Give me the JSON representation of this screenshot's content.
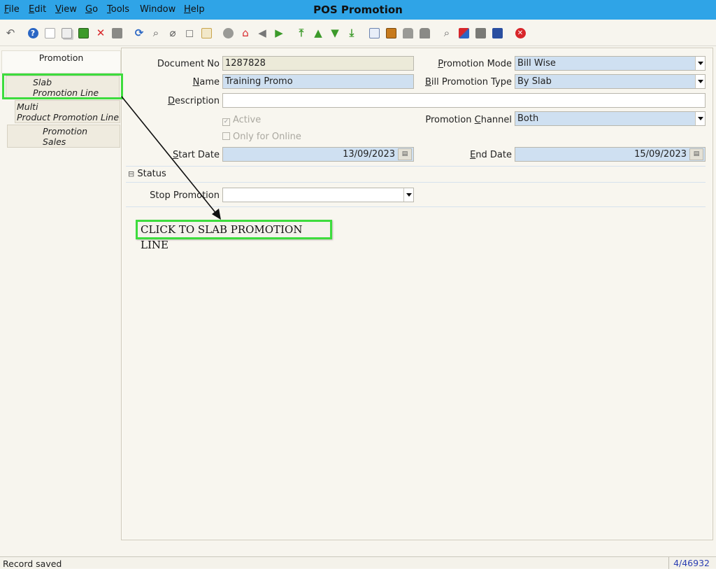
{
  "window": {
    "title": "POS Promotion"
  },
  "menu": [
    {
      "label": "File",
      "mnemonic": "F",
      "rest": "ile"
    },
    {
      "label": "Edit",
      "mnemonic": "E",
      "rest": "dit"
    },
    {
      "label": "View",
      "mnemonic": "V",
      "rest": "iew"
    },
    {
      "label": "Go",
      "mnemonic": "G",
      "rest": "o"
    },
    {
      "label": "Tools",
      "mnemonic": "T",
      "rest": "ools"
    },
    {
      "label": "Window",
      "mnemonic": "",
      "rest": "Window"
    },
    {
      "label": "Help",
      "mnemonic": "H",
      "rest": "elp"
    }
  ],
  "toolbar": {
    "icons": [
      "undo-icon",
      "help-icon",
      "new-record-icon",
      "copy-record-icon",
      "save-icon",
      "delete-icon",
      "save-disk-icon",
      "refresh-icon",
      "find-icon",
      "attachment-icon",
      "chat-icon",
      "grid-toggle-icon",
      "history-icon",
      "home-icon",
      "back-icon",
      "forward-icon",
      "first-record-icon",
      "previous-record-icon",
      "next-record-icon",
      "last-record-icon",
      "report-icon",
      "archive-icon",
      "print-preview-icon",
      "print-icon",
      "zoom-across-icon",
      "workflow-icon",
      "product-info-icon",
      "lock-icon",
      "exit-icon"
    ],
    "colors": {
      "green": "#3c9a2a",
      "blue": "#2a66c4",
      "grey": "#8a8a86",
      "red": "#d8262a",
      "orange": "#e07020"
    }
  },
  "tabs": [
    {
      "line1": "Promotion",
      "line2": ""
    },
    {
      "line1": "Slab",
      "line2": "Promotion Line"
    },
    {
      "line1": "Multi",
      "line2": "Product Promotion Line"
    },
    {
      "line1": "Promotion",
      "line2": "Sales"
    }
  ],
  "form": {
    "document_no": {
      "label": "Document No",
      "value": "1287828"
    },
    "name": {
      "label_mn": "N",
      "label_rest": "ame",
      "value": "Training Promo"
    },
    "description": {
      "label_mn": "D",
      "label_rest": "escription",
      "value": ""
    },
    "active": {
      "label": "Active",
      "checked": true
    },
    "only_online": {
      "label": "Only for Online",
      "checked": false
    },
    "start_date": {
      "label_mn": "S",
      "label_rest": "tart Date",
      "value": "13/09/2023"
    },
    "promotion_mode": {
      "label_mn": "P",
      "label_rest": "romotion Mode",
      "value": "Bill Wise"
    },
    "bill_promotion_type": {
      "label_mn": "B",
      "label_rest": "ill Promotion Type",
      "value": "By Slab"
    },
    "promotion_channel": {
      "label_pre": "Promotion ",
      "label_mn": "C",
      "label_rest": "hannel",
      "value": "Both"
    },
    "end_date": {
      "label_mn": "E",
      "label_rest": "nd Date",
      "value": "15/09/2023"
    },
    "calendar_glyph": "▤"
  },
  "status_section": {
    "header": "Status",
    "toggle_glyph": "⊟",
    "stop_promotion": {
      "label": "Stop Promotion",
      "value": ""
    }
  },
  "callout": {
    "text": "CLICK TO SLAB PROMOTION LINE",
    "color": "#3ddc3d"
  },
  "statusbar": {
    "message": "Record saved",
    "record": "4/46932"
  }
}
